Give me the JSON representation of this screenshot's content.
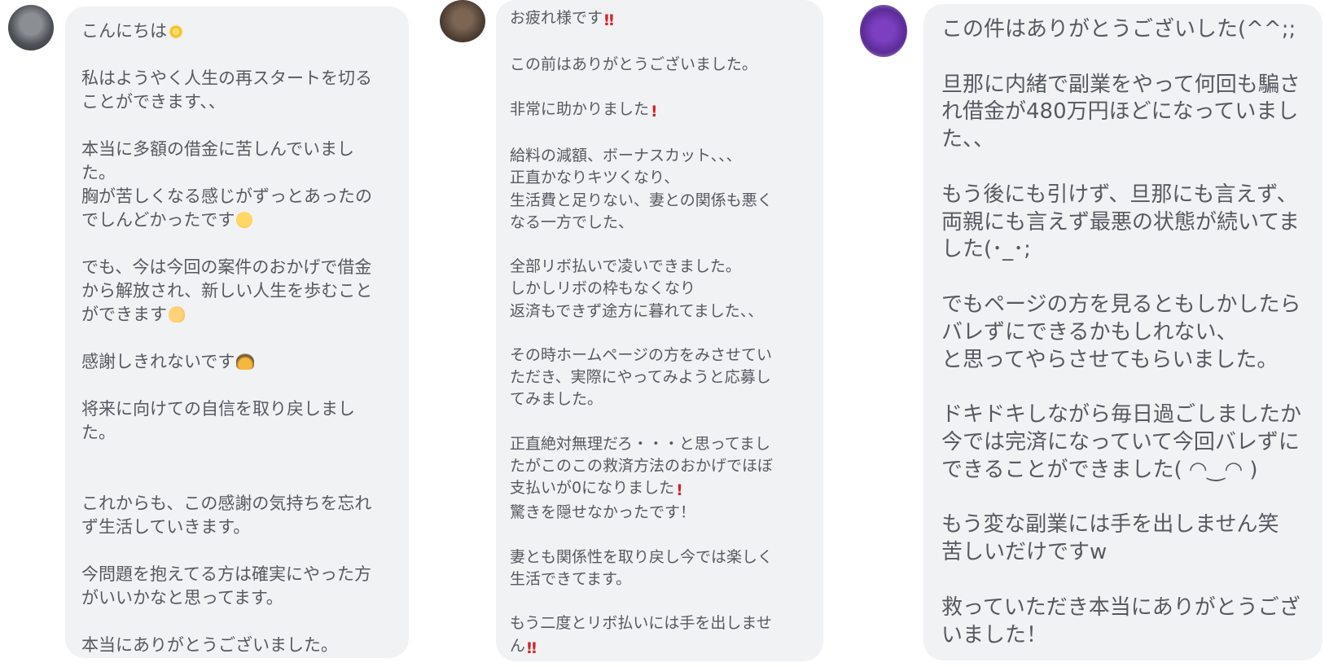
{
  "messages": [
    {
      "lines": [
        "こんにちは",
        "",
        "私はようやく人生の再スタートを切る",
        "ことができます、、",
        "",
        "本当に多額の借金に苦しんでいまし",
        "た。",
        "胸が苦しくなる感じがずっとあったの",
        "でしんどかったです",
        "",
        "でも、今は今回の案件のおかげで借金",
        "から解放され、新しい人生を歩むこと",
        "ができます",
        "",
        "感謝しきれないです",
        "",
        "将来に向けての自信を取り戻しまし",
        "た。",
        "",
        "",
        "これからも、この感謝の気持ちを忘れ",
        "ず生活していきます。",
        "",
        "今問題を抱えてる方は確実にやった方",
        "がいいかなと思ってます。",
        "",
        "本当にありがとうございました。"
      ],
      "emojis": {
        "0": "sparkles-icon",
        "8": "teary-face-icon",
        "12": "ok-hand-icon",
        "14": "bowing-person-icon"
      }
    },
    {
      "lines": [
        "お疲れ様です",
        "",
        "この前はありがとうございました。",
        "",
        "非常に助かりました",
        "",
        "給料の減額、ボーナスカット、、、",
        "正直かなりキツくなり、",
        "生活費と足りない、妻との関係も悪く",
        "なる一方でした、",
        "",
        "全部リボ払いで凌いできました。",
        "しかしリボの枠もなくなり",
        "返済もできず途方に暮れてました、、",
        "",
        "その時ホームページの方をみさせてい",
        "ただき、実際にやってみようと応募し",
        "てみました。",
        "",
        "正直絶対無理だろ・・・と思ってまし",
        "たがこのこの救済方法のおかげでほぼ",
        "支払いが0になりました",
        "驚きを隠せなかったです！",
        "",
        "妻とも関係性を取り戻し今では楽しく",
        "生活できてます。",
        "",
        "もう二度とリボ払いには手を出しませ",
        "ん"
      ],
      "emojis": {
        "0": "double-exclamation-icon",
        "4": "exclamation-icon",
        "21": "exclamation-icon",
        "28": "double-exclamation-icon"
      }
    },
    {
      "lines": [
        "この件はありがとうございした(^^;;",
        "",
        "旦那に内緒で副業をやって何回も騙さ",
        "れ借金が480万円ほどになっていまし",
        "た、、",
        "",
        "もう後にも引けず、旦那にも言えず、",
        "両親にも言えず最悪の状態が続いてま",
        "した(･_･;",
        "",
        "でもページの方を見るともしかしたら",
        "バレずにできるかもしれない、",
        "と思ってやらさせてもらいました。",
        "",
        "ドキドキしながら毎日過ごしましたか",
        "今では完済になっていて今回バレずに",
        "できることができました( ◠‿◠ )",
        "",
        "もう変な副業には手を出しません笑",
        "苦しいだけですw",
        "",
        "救っていただき本当にありがとうござ",
        "いました！"
      ],
      "emojis": {}
    }
  ]
}
